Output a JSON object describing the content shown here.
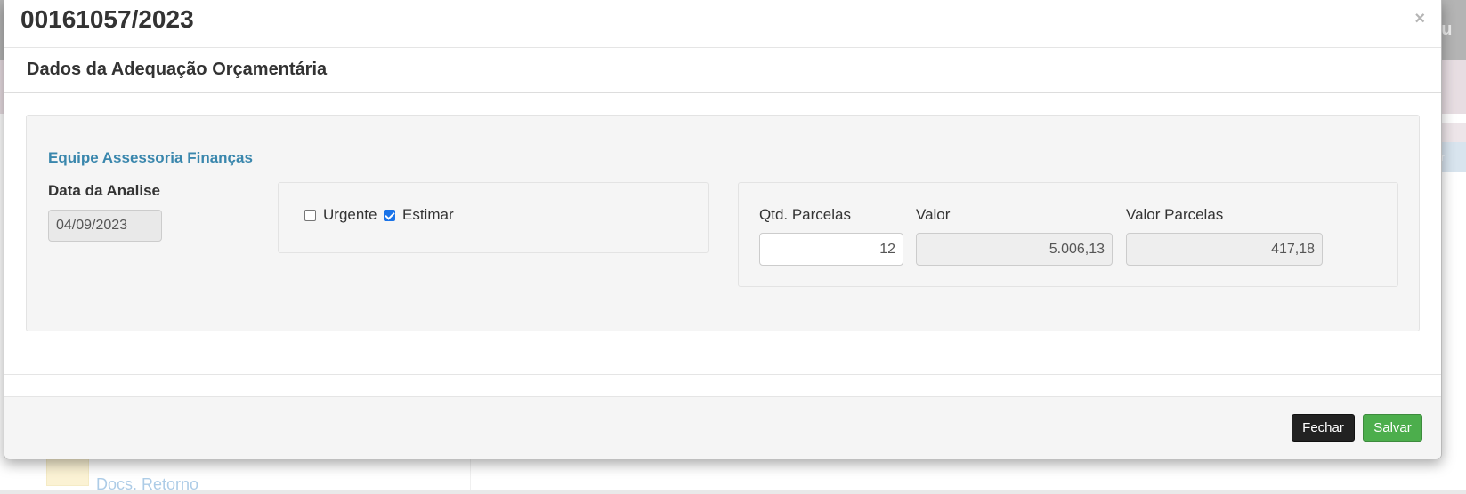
{
  "background": {
    "top_text": "du",
    "blue_button_text": "ar",
    "tree_link": "Docs. Retorno"
  },
  "modal": {
    "title": "00161057/2023",
    "close_glyph": "×",
    "section_title": "Dados da Adequação Orçamentária",
    "team_title": "Equipe Assessoria Finanças",
    "date_label": "Data da Analise",
    "date_value": "04/09/2023",
    "checks": [
      {
        "label": "Urgente",
        "checked": false
      },
      {
        "label": "Estimar",
        "checked": true
      }
    ],
    "values": {
      "qtd_parcelas_label": "Qtd. Parcelas",
      "qtd_parcelas_value": "12",
      "valor_label": "Valor",
      "valor_value": "5.006,13",
      "valor_parcelas_label": "Valor Parcelas",
      "valor_parcelas_value": "417,18"
    },
    "footer": {
      "close_label": "Fechar",
      "save_label": "Salvar"
    }
  },
  "colors": {
    "team_title": "#3a87ad",
    "save_button": "#4cae4c",
    "close_button": "#222222",
    "checkbox_checked": "#1a73e8"
  }
}
